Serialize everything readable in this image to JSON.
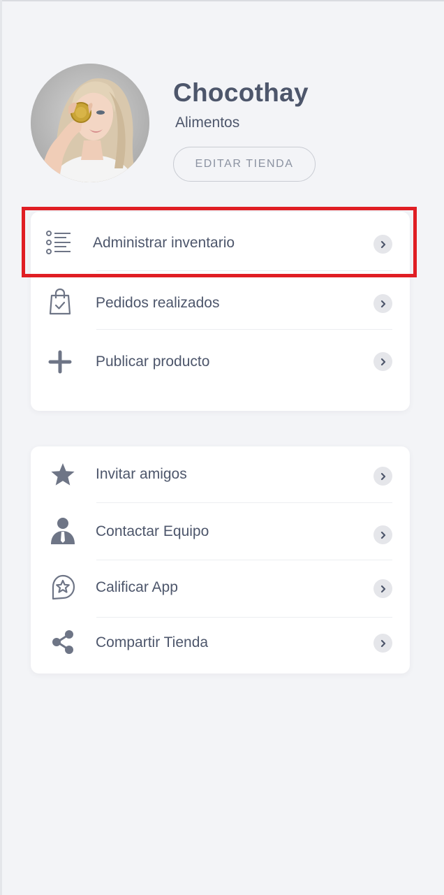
{
  "profile": {
    "store_name": "Chocothay",
    "category": "Alimentos",
    "edit_button": "EDITAR TIENDA"
  },
  "menu_card_1": [
    {
      "label": "Administrar inventario",
      "icon": "list-icon"
    },
    {
      "label": "Pedidos realizados",
      "icon": "shopping-bag-check-icon"
    },
    {
      "label": "Publicar producto",
      "icon": "plus-icon"
    }
  ],
  "menu_card_2": [
    {
      "label": "Invitar amigos",
      "icon": "star-icon"
    },
    {
      "label": "Contactar Equipo",
      "icon": "person-icon"
    },
    {
      "label": "Calificar App",
      "icon": "star-badge-icon"
    },
    {
      "label": "Compartir Tienda",
      "icon": "share-icon"
    }
  ],
  "colors": {
    "background": "#f3f4f7",
    "text": "#4d566b",
    "icon": "#6e7586",
    "highlight": "#e01e24"
  }
}
